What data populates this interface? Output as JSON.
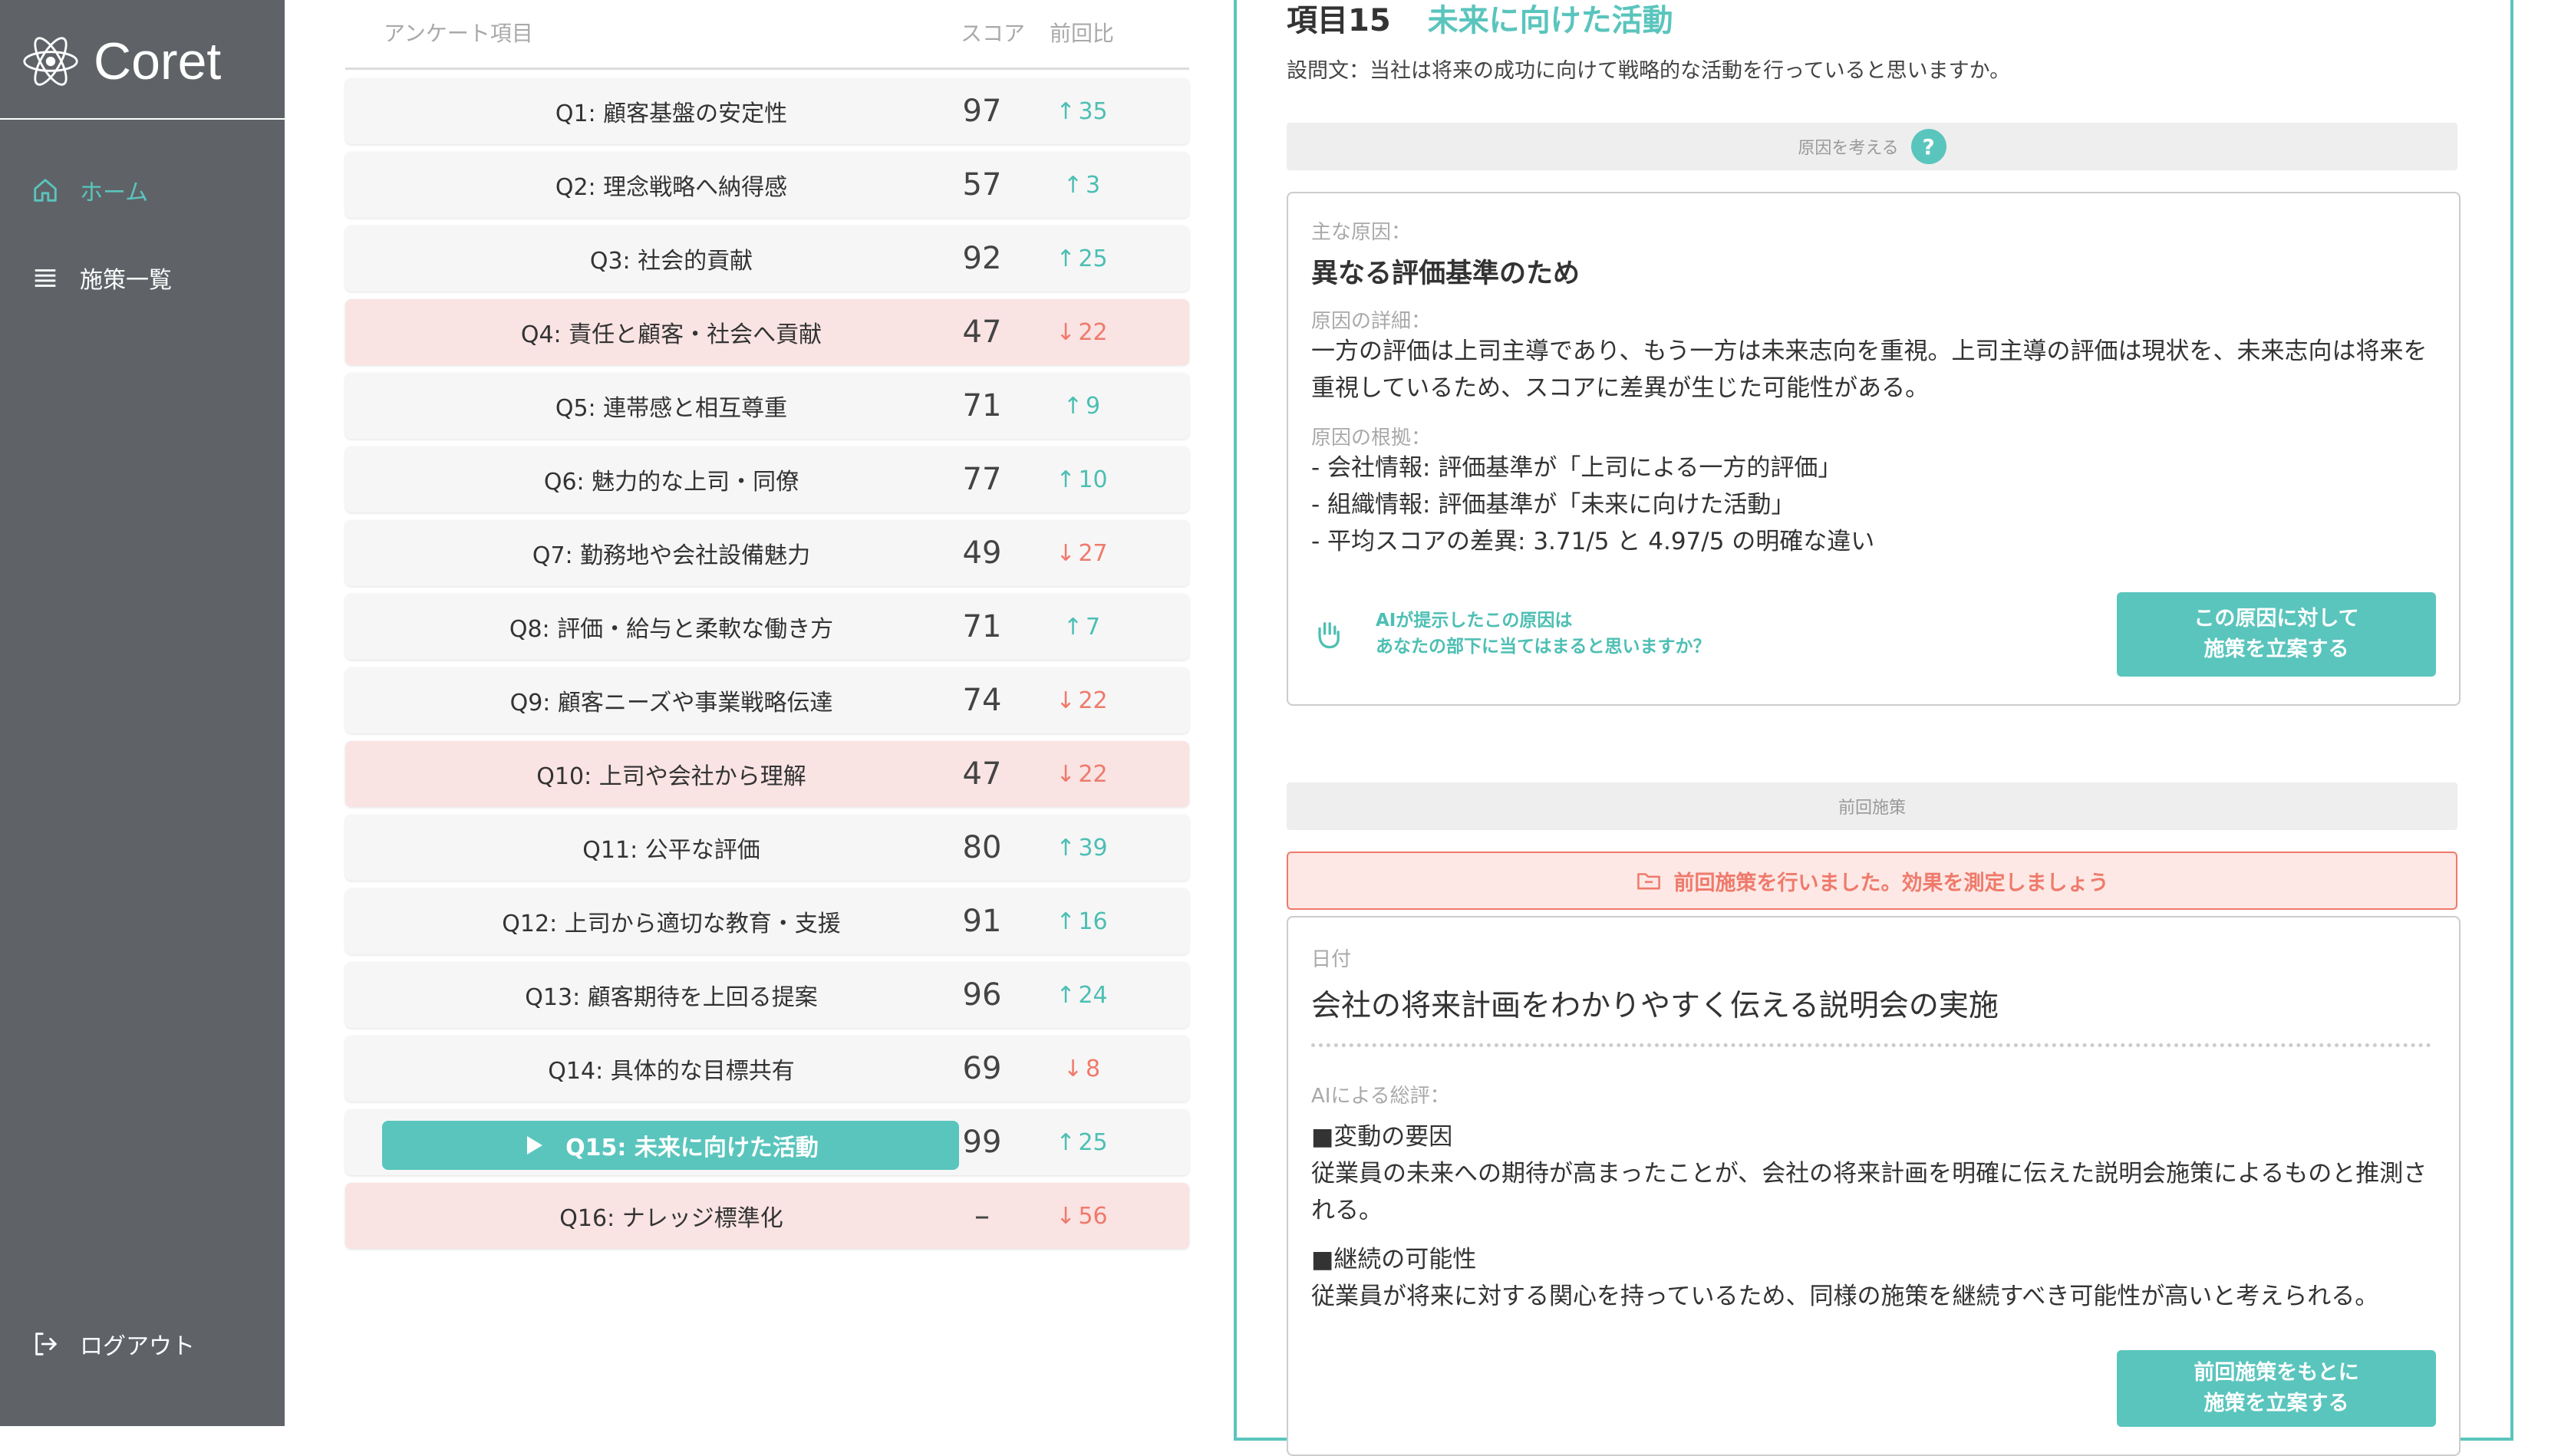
{
  "app": {
    "brand": "Coret"
  },
  "nav": {
    "home": "ホーム",
    "measures": "施策一覧",
    "logout": "ログアウト"
  },
  "list": {
    "headers": {
      "item": "アンケート項目",
      "score": "スコア",
      "diff": "前回比"
    },
    "rows": [
      {
        "label": "Q1: 顧客基盤の安定性",
        "score": "97",
        "diff": "35",
        "dir": "up"
      },
      {
        "label": "Q2: 理念戦略へ納得感",
        "score": "57",
        "diff": "3",
        "dir": "up"
      },
      {
        "label": "Q3: 社会的貢献",
        "score": "92",
        "diff": "25",
        "dir": "up"
      },
      {
        "label": "Q4: 責任と顧客・社会へ貢献",
        "score": "47",
        "diff": "22",
        "dir": "down",
        "highlight": true
      },
      {
        "label": "Q5: 連帯感と相互尊重",
        "score": "71",
        "diff": "9",
        "dir": "up"
      },
      {
        "label": "Q6: 魅力的な上司・同僚",
        "score": "77",
        "diff": "10",
        "dir": "up"
      },
      {
        "label": "Q7: 勤務地や会社設備魅力",
        "score": "49",
        "diff": "27",
        "dir": "down"
      },
      {
        "label": "Q8: 評価・給与と柔軟な働き方",
        "score": "71",
        "diff": "7",
        "dir": "up"
      },
      {
        "label": "Q9: 顧客ニーズや事業戦略伝達",
        "score": "74",
        "diff": "22",
        "dir": "down"
      },
      {
        "label": "Q10: 上司や会社から理解",
        "score": "47",
        "diff": "22",
        "dir": "down",
        "highlight": true
      },
      {
        "label": "Q11: 公平な評価",
        "score": "80",
        "diff": "39",
        "dir": "up"
      },
      {
        "label": "Q12: 上司から適切な教育・支援",
        "score": "91",
        "diff": "16",
        "dir": "up"
      },
      {
        "label": "Q13: 顧客期待を上回る提案",
        "score": "96",
        "diff": "24",
        "dir": "up"
      },
      {
        "label": "Q14: 具体的な目標共有",
        "score": "69",
        "diff": "8",
        "dir": "down"
      },
      {
        "label": "Q15: 未来に向けた活動",
        "score": "99",
        "diff": "25",
        "dir": "up",
        "selected": true
      },
      {
        "label": "Q16: ナレッジ標準化",
        "score": "–",
        "diff": "56",
        "dir": "down",
        "highlight": true
      }
    ]
  },
  "detail": {
    "item_no": "項目15",
    "item_title": "未来に向けた活動",
    "question": "設問文：当社は将来の成功に向けて戦略的な活動を行っていると思いますか。",
    "cause_bar": "原因を考える",
    "help_mark": "?",
    "cause": {
      "main_label": "主な原因：",
      "main": "異なる評価基準のため",
      "detail_label": "原因の詳細：",
      "detail": "一方の評価は上司主導であり、もう一方は未来志向を重視。上司主導の評価は現状を、未来志向は将来を重視しているため、スコアに差異が生じた可能性がある。",
      "basis_label": "原因の根拠：",
      "basis": [
        "- 会社情報: 評価基準が「上司による一方的評価」",
        "- 組織情報: 評価基準が「未来に向けた活動」",
        "- 平均スコアの差異: 3.71/5 と 4.97/5 の明確な違い"
      ],
      "ai_note_line1": "AIが提示したこの原因は",
      "ai_note_line2": "あなたの部下に当てはまると思いますか？",
      "button_line1": "この原因に対して",
      "button_line2": "施策を立案する"
    },
    "prev_bar": "前回施策",
    "prev_notice": "前回施策を行いました。効果を測定しましょう",
    "prev": {
      "date_label": "日付",
      "title": "会社の将来計画をわかりやすく伝える説明会の実施",
      "review_label": "AIによる総評：",
      "factor_heading": "■変動の要因",
      "factor_text": "従業員の未来への期待が高まったことが、会社の将来計画を明確に伝えた説明会施策によるものと推測される。",
      "continuity_heading": "■継続の可能性",
      "continuity_text": "従業員が将来に対する関心を持っているため、同様の施策を継続すべき可能性が高いと考えられる。",
      "button_line1": "前回施策をもとに",
      "button_line2": "施策を立案する"
    }
  },
  "colors": {
    "accent": "#5ac5bd",
    "up": "#4dbfb3",
    "down": "#ef7a6c",
    "highlight_row": "#f9e3e3",
    "sidebar": "#5f6368"
  }
}
